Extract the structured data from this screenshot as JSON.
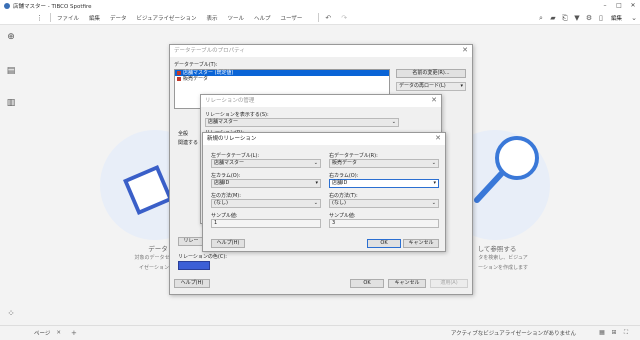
{
  "app": {
    "title": "店舗マスター - TIBCO Spotfire"
  },
  "menu": [
    "ファイル",
    "編集",
    "データ",
    "ビジュアライゼーション",
    "表示",
    "ツール",
    "ヘルプ",
    "ユーザー"
  ],
  "toolbar_right": {
    "edit_label": "編集"
  },
  "background": {
    "left_title": "データ",
    "left_line1": "対象のデータセ",
    "left_line2": "イゼーション",
    "right_title": "して参照する",
    "right_line1": "タを検索し、ビジュア",
    "right_line2": "ーションを作成します"
  },
  "dlg1": {
    "title": "データテーブルのプロパティ",
    "tables_label": "データテーブル(T):",
    "tables": [
      {
        "name": "店舗マスター (既定値)",
        "color": "#c0392b",
        "selected": true
      },
      {
        "name": "販売データ",
        "color": "#c0392b",
        "selected": false
      }
    ],
    "rename_btn": "名前の変更(R)...",
    "refresh_btn": "データの再ロード(L)",
    "label_general": "全般",
    "label_relations": "関連する",
    "relation_btn": "リレー",
    "color_label": "リレーションの色(C):",
    "help_btn": "ヘルプ(H)",
    "ok_btn": "OK",
    "cancel_btn": "キャンセル",
    "apply_btn": "適用(A)"
  },
  "dlg2": {
    "title": "リレーションの管理",
    "show_label": "リレーションを表示する(S):",
    "show_value": "店舗マスター",
    "relations_label": "リレーション(R):"
  },
  "dlg3": {
    "title": "新規のリレーション",
    "left_table_label": "左データテーブル(L):",
    "left_table_value": "店舗マスター",
    "right_table_label": "右データテーブル(R):",
    "right_table_value": "販売データ",
    "left_col_label": "左カラム(O):",
    "left_col_value": "店舗ID",
    "right_col_label": "右カラム(O):",
    "right_col_value": "店舗ID",
    "left_method_label": "左の方法(M):",
    "left_method_value": "(なし)",
    "right_method_label": "右の方法(T):",
    "right_method_value": "(なし)",
    "sample_left_label": "サンプル値:",
    "sample_left_value": "1",
    "sample_right_label": "サンプル値:",
    "sample_right_value": "3",
    "help_btn": "ヘルプ(H)",
    "ok_btn": "OK",
    "cancel_btn": "キャンセル"
  },
  "status": {
    "page_tab": "ページ",
    "message": "アクティブなビジュアライゼーションがありません"
  },
  "colors": {
    "accent": "#0a64d6",
    "relation_color": "#3c5fd6"
  }
}
